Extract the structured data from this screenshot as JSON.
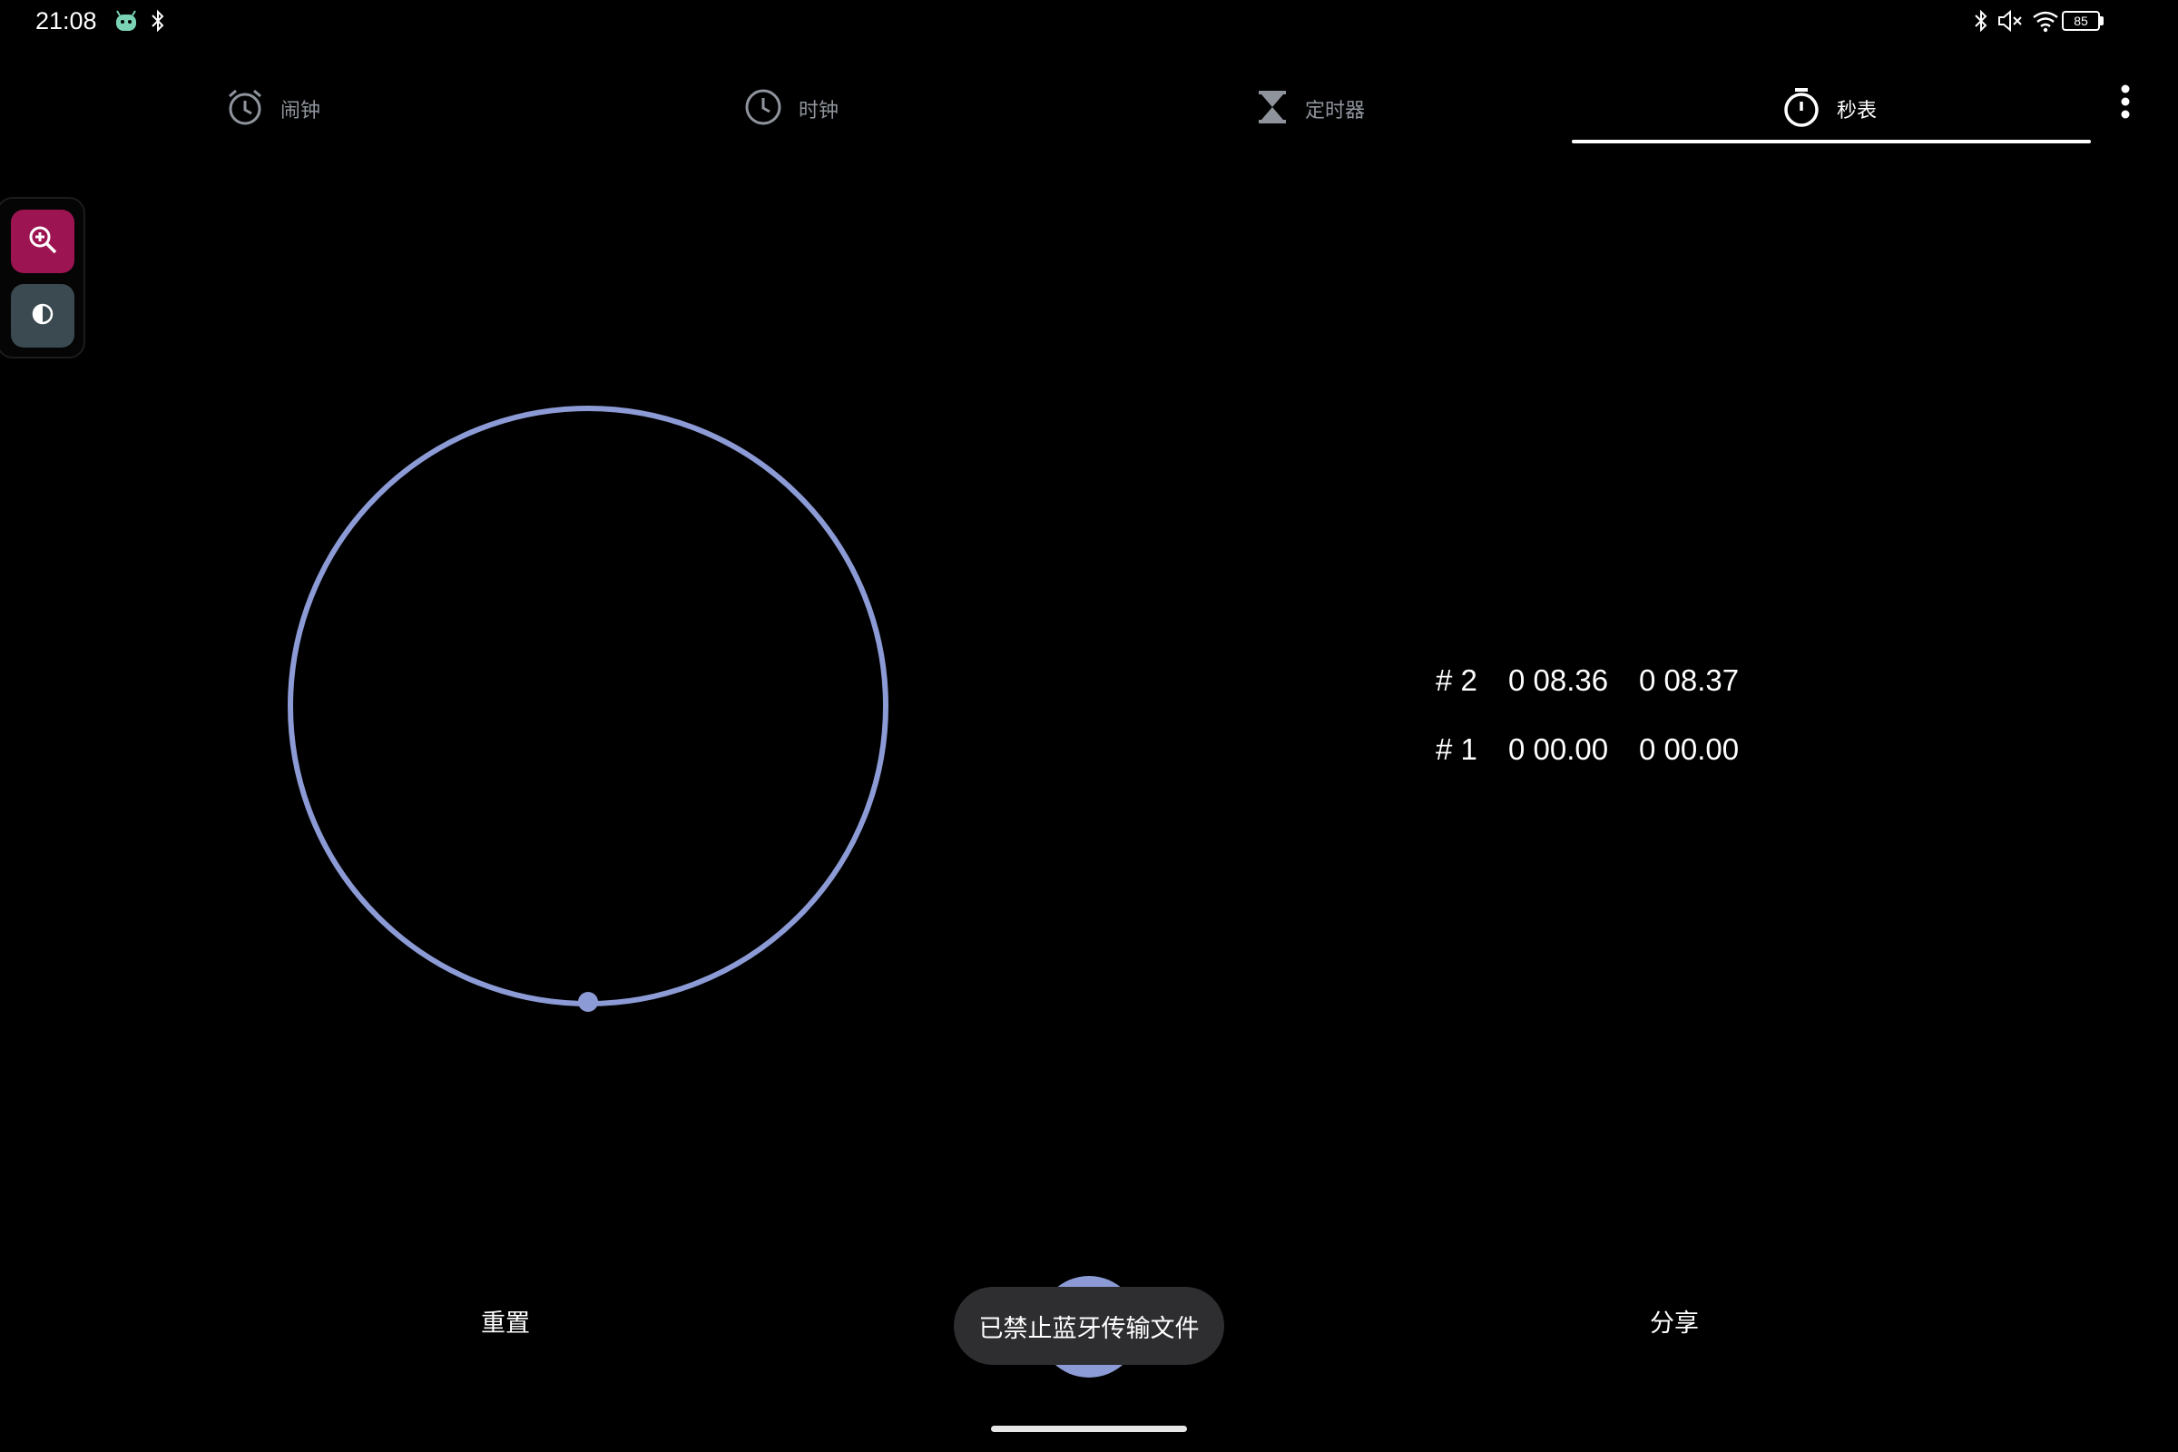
{
  "status_bar": {
    "time": "21:08",
    "battery": "85",
    "icons": [
      "app-notification-icon",
      "bluetooth-icon",
      "bluetooth-icon",
      "mute-icon",
      "wifi-icon",
      "battery-icon"
    ]
  },
  "tabs": [
    {
      "label": "闹钟",
      "icon": "alarm-icon",
      "active": false
    },
    {
      "label": "时钟",
      "icon": "clock-icon",
      "active": false
    },
    {
      "label": "定时器",
      "icon": "hourglass-icon",
      "active": false
    },
    {
      "label": "秒表",
      "icon": "stopwatch-icon",
      "active": true
    }
  ],
  "float_panel": {
    "buttons": [
      "zoom-in-icon",
      "contrast-icon"
    ]
  },
  "laps": [
    {
      "number": "# 2",
      "lap_time": "0 08.36",
      "total_time": "0 08.37"
    },
    {
      "number": "# 1",
      "lap_time": "0 00.00",
      "total_time": "0 00.00"
    }
  ],
  "controls": {
    "reset_label": "重置",
    "share_label": "分享"
  },
  "toast": {
    "message": "已禁止蓝牙传输文件"
  },
  "colors": {
    "accent": "#8c9bd6",
    "background": "#000000",
    "zoom_button": "#9c1451",
    "contrast_button": "#3a4a50",
    "inactive_tab": "#8f949c"
  }
}
